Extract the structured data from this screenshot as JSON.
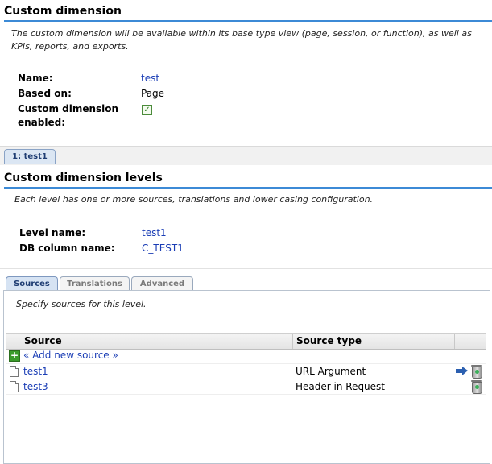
{
  "header": {
    "title": "Custom dimension",
    "description": "The custom dimension will be available within its base type view (page, session, or function), as well as KPIs, reports, and exports."
  },
  "fields": {
    "name_label": "Name:",
    "name_value": "test",
    "based_on_label": "Based on:",
    "based_on_value": "Page",
    "enabled_label_line1": "Custom dimension",
    "enabled_label_line2": "enabled:",
    "enabled_checked": true
  },
  "level_tabs": [
    {
      "label": "1: test1",
      "active": true
    }
  ],
  "levels": {
    "title": "Custom dimension levels",
    "description": "Each level has one or more sources, translations and lower casing configuration.",
    "level_name_label": "Level name:",
    "level_name_value": "test1",
    "db_column_label": "DB column name:",
    "db_column_value": "C_TEST1"
  },
  "inner_tabs": [
    {
      "label": "Sources",
      "active": true
    },
    {
      "label": "Translations",
      "active": false
    },
    {
      "label": "Advanced",
      "active": false
    }
  ],
  "sources": {
    "description": "Specify sources for this level.",
    "columns": [
      "Source",
      "Source type"
    ],
    "add_label": "« Add new source »",
    "rows": [
      {
        "source": "test1",
        "type": "URL Argument",
        "icons": [
          "move-icon",
          "trash-icon"
        ]
      },
      {
        "source": "test3",
        "type": "Header in Request",
        "icons": [
          "trash-icon"
        ]
      }
    ]
  },
  "colors": {
    "accent_rule": "#3c8ad6",
    "link": "#1a3db5"
  }
}
